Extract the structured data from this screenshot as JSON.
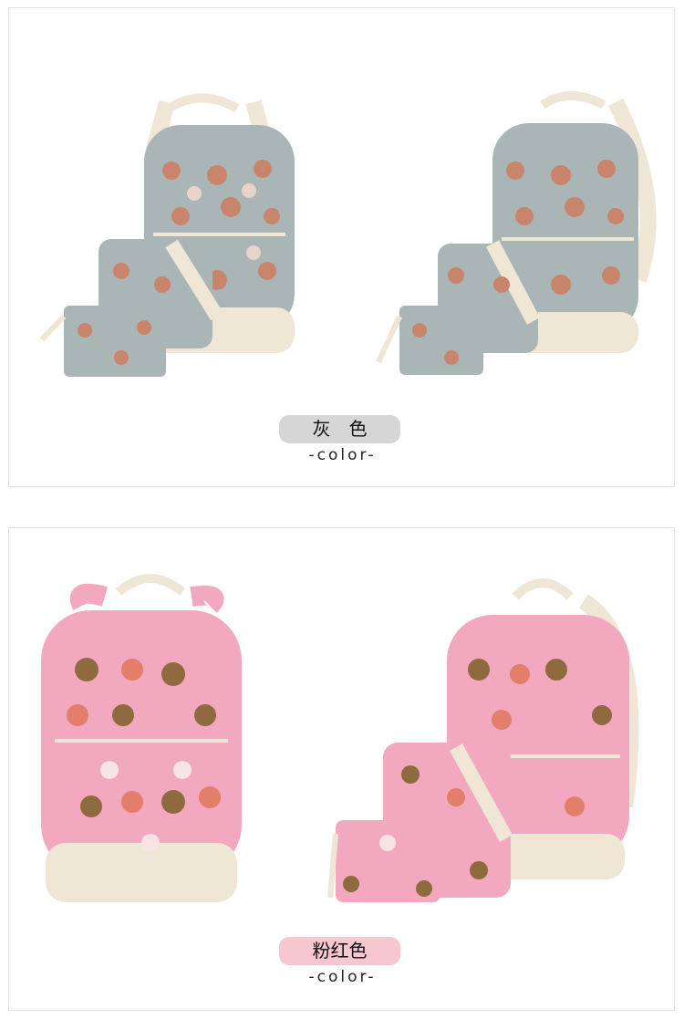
{
  "sections": [
    {
      "color_label": "灰　色",
      "caption": "-color-",
      "badge_color": "#d6d6d6",
      "fabric_color": "#aab5b6",
      "trim_color": "#efe6d6"
    },
    {
      "color_label": "粉红色",
      "caption": "-color-",
      "badge_color": "#f7c7cf",
      "fabric_color": "#f2a9bf",
      "trim_color": "#efe6d6"
    }
  ],
  "icons": [
    "backpack-set-photo",
    "backpack-photo"
  ]
}
